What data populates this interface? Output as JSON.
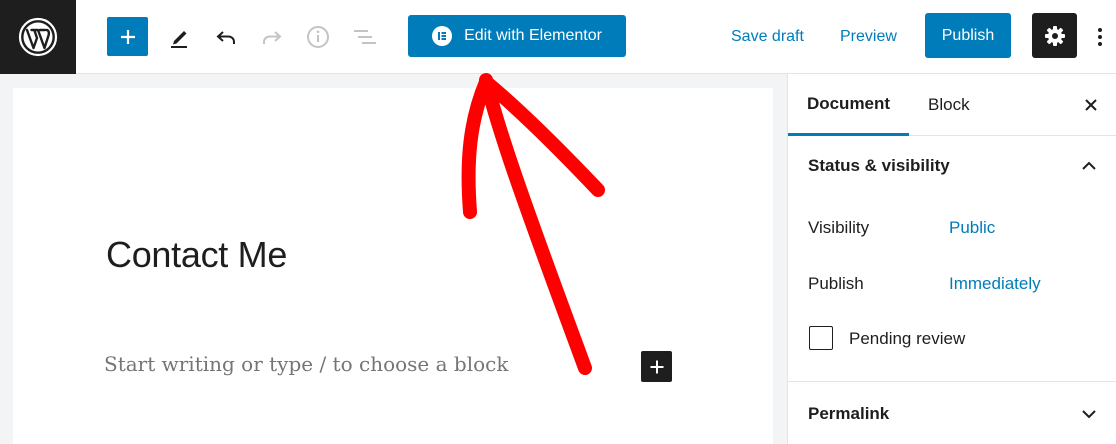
{
  "toolbar": {
    "edit_with_elementor": "Edit with Elementor",
    "save_draft": "Save draft",
    "preview": "Preview",
    "publish": "Publish",
    "icons": {
      "logo": "wordpress-logo-icon",
      "add": "plus-icon",
      "tools": "pencil-icon",
      "undo": "undo-icon",
      "redo": "redo-icon",
      "info": "info-icon",
      "outline": "list-outline-icon",
      "settings": "gear-icon",
      "more": "vertical-ellipsis-icon"
    }
  },
  "editor": {
    "title": "Contact Me",
    "block_placeholder": "Start writing or type / to choose a block"
  },
  "sidebar": {
    "tabs": [
      {
        "label": "Document",
        "active": true
      },
      {
        "label": "Block",
        "active": false
      }
    ],
    "status_visibility": {
      "title": "Status & visibility",
      "visibility_label": "Visibility",
      "visibility_value": "Public",
      "publish_label": "Publish",
      "publish_value": "Immediately",
      "pending_review_label": "Pending review",
      "pending_review_checked": false
    },
    "permalink": {
      "title": "Permalink"
    }
  },
  "colors": {
    "accent": "#007cba",
    "dark": "#1e1e1e",
    "annotation_arrow": "#ff0000"
  }
}
